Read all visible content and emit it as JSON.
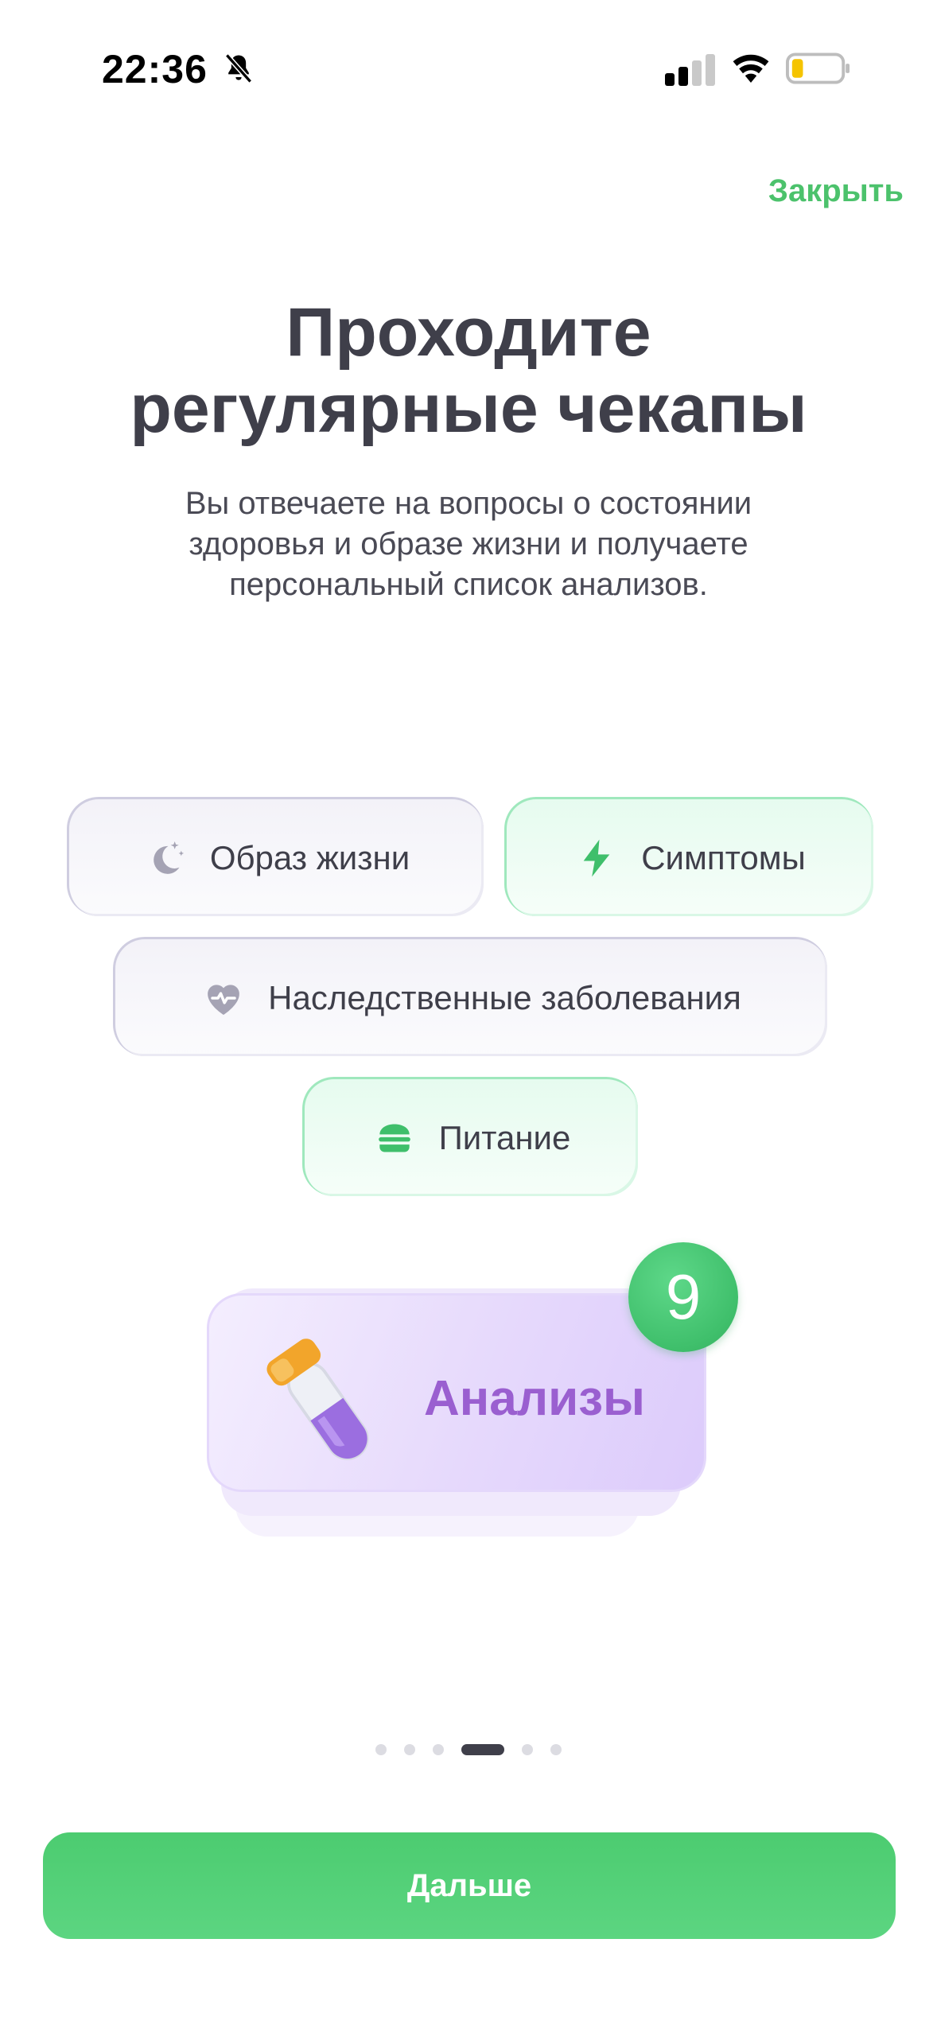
{
  "status_bar": {
    "time": "22:36",
    "battery_color": "#f5c400"
  },
  "header": {
    "close_label": "Закрыть"
  },
  "onboarding": {
    "title_lines": [
      "Проходите",
      "регулярные чекапы"
    ],
    "subtitle_lines": [
      "Вы отвечаете на вопросы о состоянии",
      "здоровья и образе жизни и получаете",
      "персональный список анализов."
    ],
    "chips": [
      {
        "label": "Образ жизни",
        "icon": "moon-stars-icon",
        "style": "gray"
      },
      {
        "label": "Симптомы",
        "icon": "lightning-icon",
        "style": "green"
      },
      {
        "label": "Наследственные заболевания",
        "icon": "heart-pulse-icon",
        "style": "gray"
      },
      {
        "label": "Питание",
        "icon": "burger-icon",
        "style": "green"
      }
    ],
    "analysis_card": {
      "label": "Анализы",
      "count": "9",
      "icon": "test-tube-icon"
    },
    "pager": {
      "total": 6,
      "active_index": 3
    }
  },
  "footer": {
    "next_label": "Дальше"
  },
  "colors": {
    "accent_green": "#4cc26c",
    "text_dark": "#3f3f4a",
    "analysis_purple": "#9a5fd0"
  }
}
